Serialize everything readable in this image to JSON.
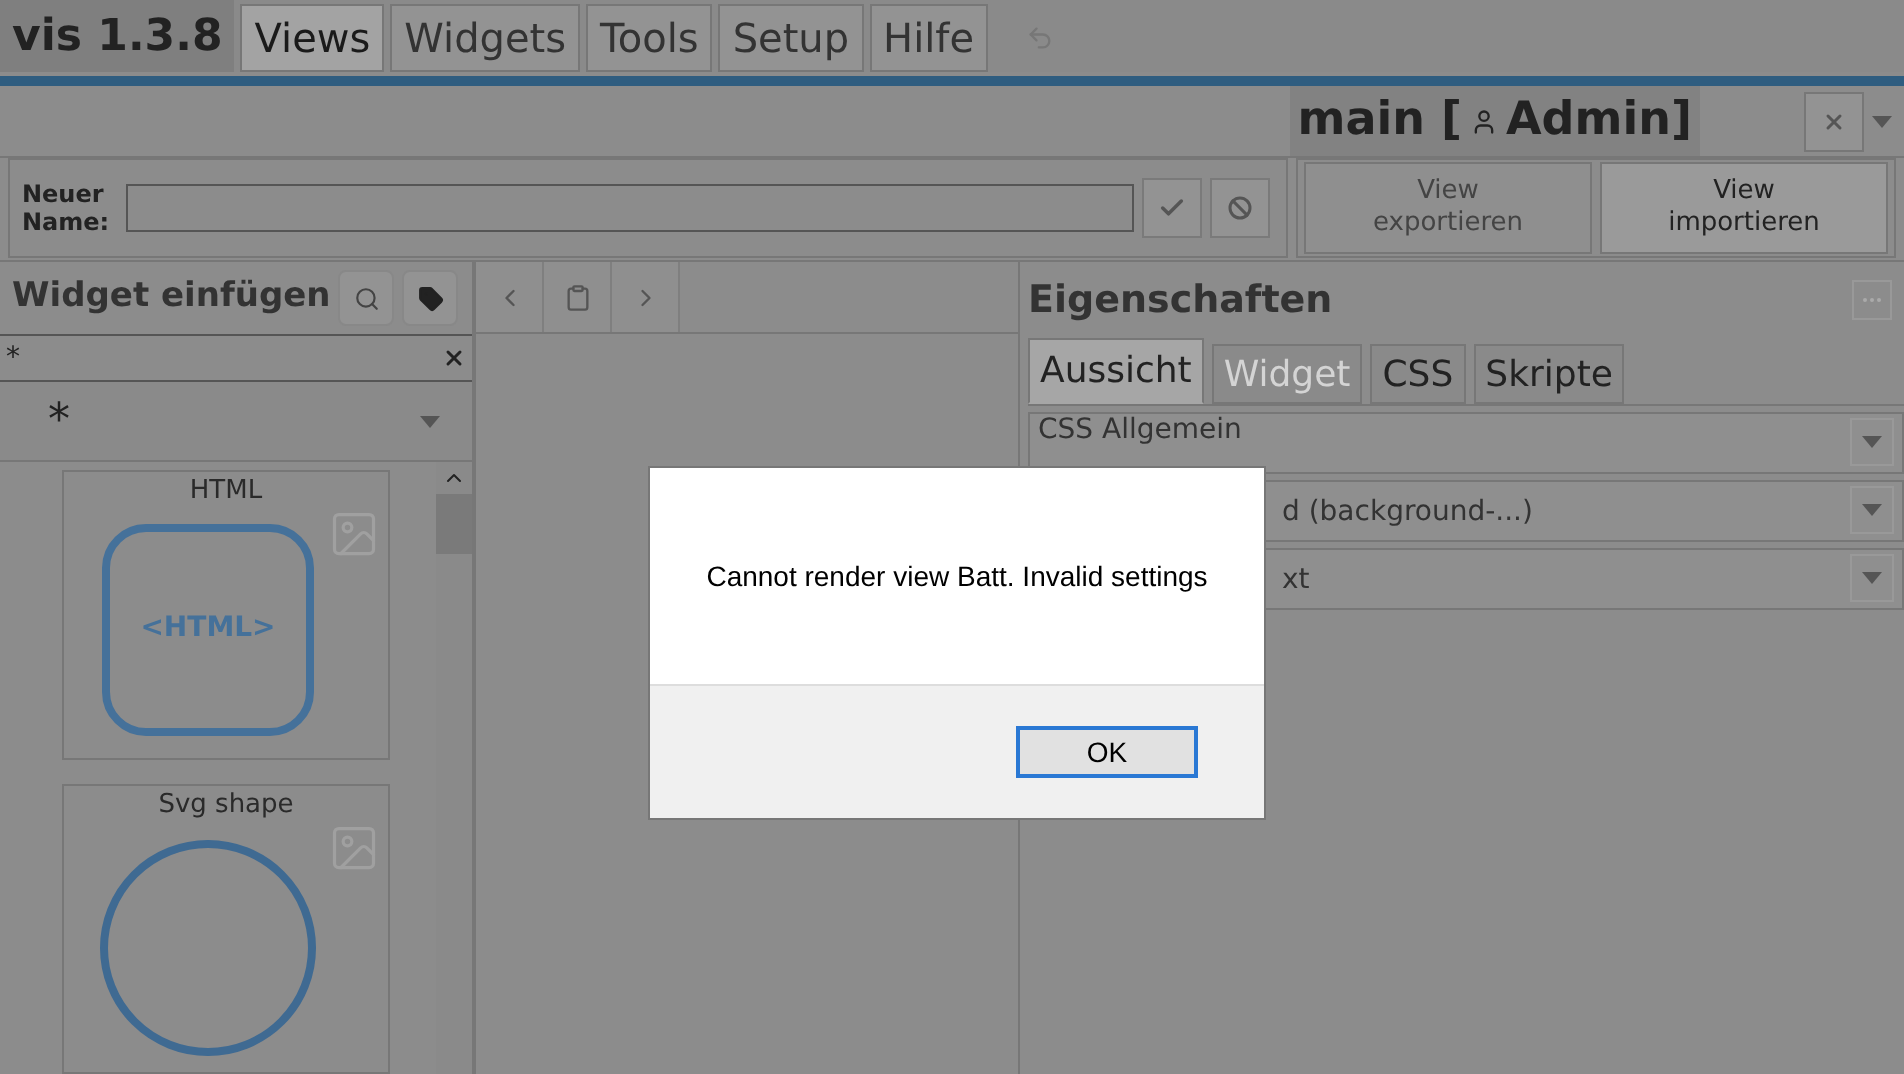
{
  "app": {
    "title": "vis 1.3.8"
  },
  "menu_tabs": [
    {
      "label": "Views",
      "selected": true
    },
    {
      "label": "Widgets",
      "selected": false
    },
    {
      "label": "Tools",
      "selected": false
    },
    {
      "label": "Setup",
      "selected": false
    },
    {
      "label": "Hilfe",
      "selected": false
    }
  ],
  "view_header": {
    "title": "main [",
    "user": "Admin]"
  },
  "rename": {
    "label": "Neuer Name:"
  },
  "view_buttons": [
    "View exportieren",
    "View importieren"
  ],
  "widget_panel": {
    "title": "Widget einfügen",
    "filter": {
      "value": "*"
    },
    "set_select": {
      "value": "*"
    },
    "widgets": [
      {
        "name": "HTML",
        "kind": "html",
        "preview": "<HTML>"
      },
      {
        "name": "Svg shape",
        "kind": "svg"
      }
    ]
  },
  "properties": {
    "title": "Eigenschaften",
    "tabs": [
      {
        "label": "Aussicht",
        "selected": true,
        "disabled": false
      },
      {
        "label": "Widget",
        "selected": false,
        "disabled": true
      },
      {
        "label": "CSS",
        "selected": false,
        "disabled": false
      },
      {
        "label": "Skripte",
        "selected": false,
        "disabled": false
      }
    ],
    "sections": [
      "CSS Allgemein",
      "d (background-...)",
      "xt"
    ]
  },
  "dialog": {
    "message": "Cannot render view Batt. Invalid settings",
    "button": "OK"
  }
}
